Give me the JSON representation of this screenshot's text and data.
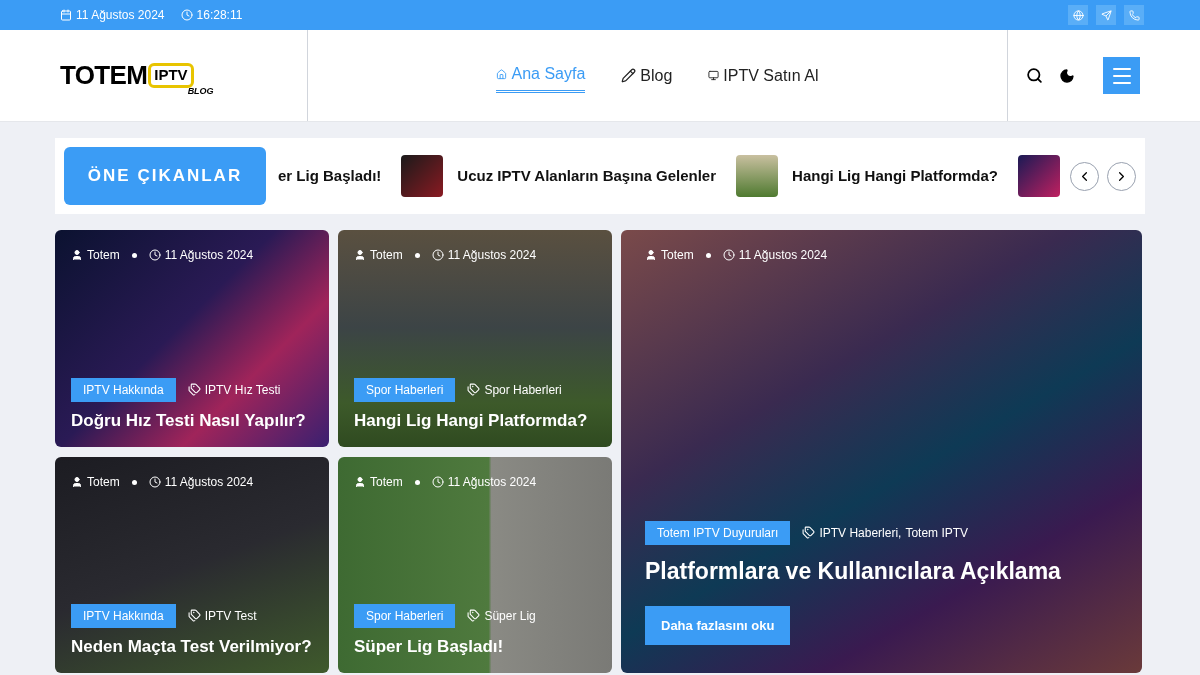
{
  "top_bar": {
    "date": "11 Ağustos 2024",
    "time": "16:28:11"
  },
  "logo": {
    "word": "TOTEM",
    "badge": "IPTV",
    "sub": "BLOG"
  },
  "nav": [
    {
      "label": "Ana Sayfa",
      "selected": true
    },
    {
      "label": "Blog",
      "selected": false
    },
    {
      "label": "IPTV Satın Al",
      "selected": false
    }
  ],
  "ticker": {
    "label": "ÖNE ÇIKANLAR",
    "items": [
      {
        "title": "er Lig Başladı!",
        "thumb": false
      },
      {
        "title": "Ucuz IPTV Alanların Başına Gelenler",
        "thumb": true
      },
      {
        "title": "Hangi Lig Hangi Platformda?",
        "thumb": true
      },
      {
        "thumb": true
      }
    ]
  },
  "posts": [
    {
      "author": "Totem",
      "date": "11 Ağustos 2024",
      "category": "IPTV Hakkında",
      "tags": [
        "IPTV Hız Testi"
      ],
      "title": "Doğru Hız Testi Nasıl Yapılır?"
    },
    {
      "author": "Totem",
      "date": "11 Ağustos 2024",
      "category": "Spor Haberleri",
      "tags": [
        "Spor Haberleri"
      ],
      "title": "Hangi Lig Hangi Platformda?"
    },
    {
      "author": "Totem",
      "date": "11 Ağustos 2024",
      "category": "IPTV Hakkında",
      "tags": [
        "IPTV Test"
      ],
      "title": "Neden Maçta Test Verilmiyor?"
    },
    {
      "author": "Totem",
      "date": "11 Ağustos 2024",
      "category": "Spor Haberleri",
      "tags": [
        "Süper Lig"
      ],
      "title": "Süper Lig Başladı!"
    }
  ],
  "featured": {
    "author": "Totem",
    "date": "11 Ağustos 2024",
    "category": "Totem IPTV Duyuruları",
    "tags": [
      "IPTV Haberleri,",
      "Totem IPTV"
    ],
    "title": "Platformlara ve Kullanıcılara Açıklama",
    "button": "Daha fazlasını oku"
  }
}
